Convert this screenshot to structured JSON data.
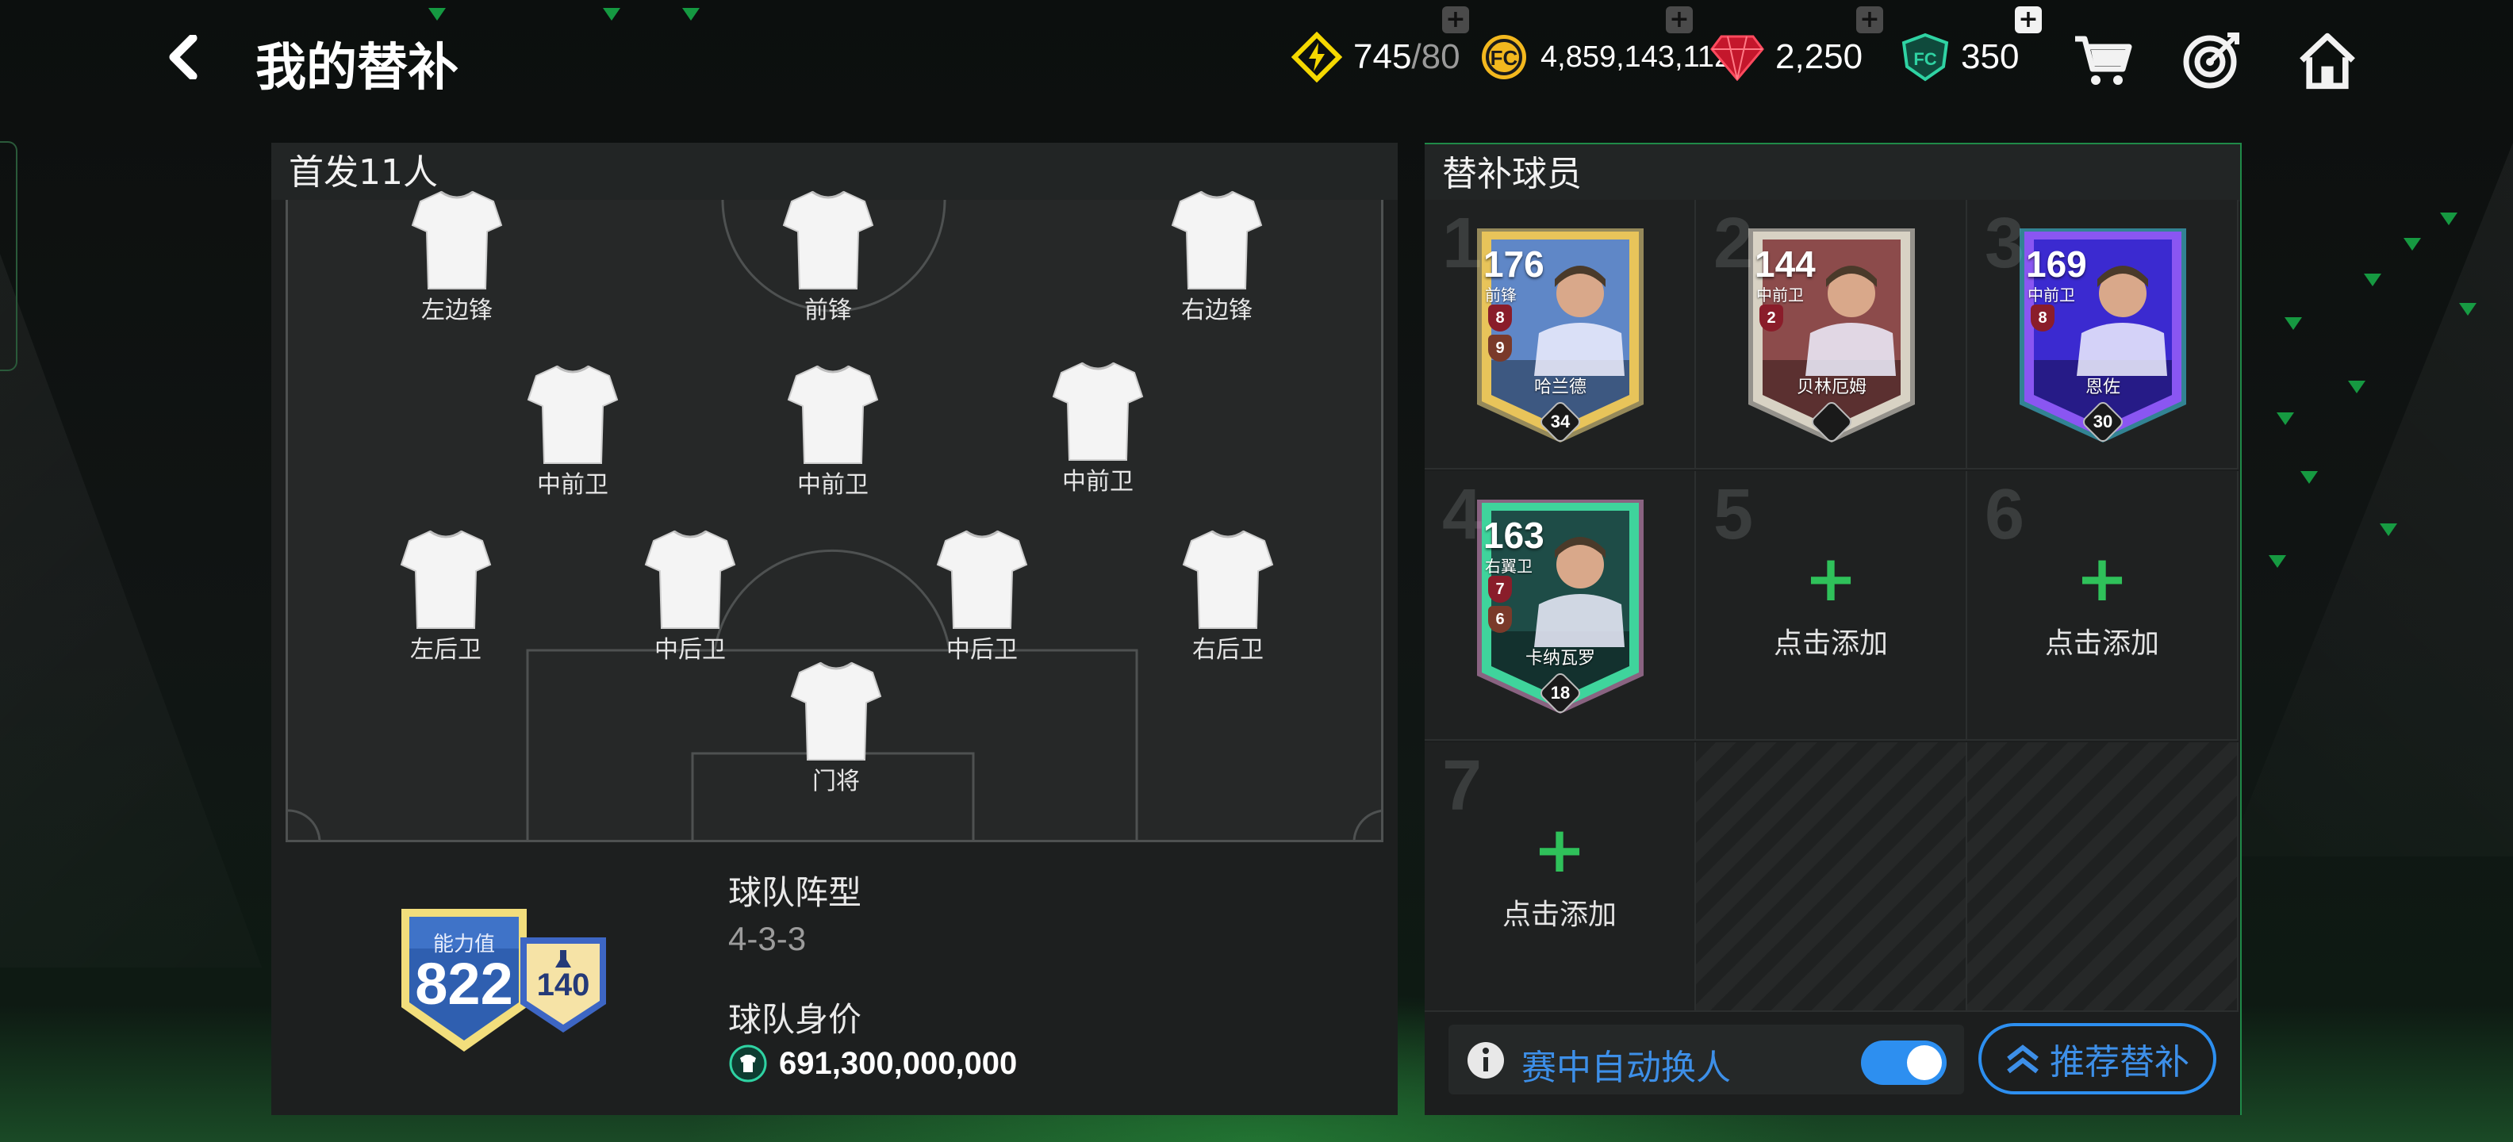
{
  "header": {
    "title": "我的替补",
    "energy": {
      "value": "745",
      "max": "/80",
      "icon": "lightning-icon"
    },
    "coins": {
      "value": "4,859,143,112",
      "icon": "coin-icon"
    },
    "gems": {
      "value": "2,250",
      "icon": "ruby-icon"
    },
    "points": {
      "value": "350",
      "icon": "shield-points-icon"
    },
    "actions": [
      "cart-icon",
      "target-icon",
      "home-icon"
    ]
  },
  "starting": {
    "title": "首发11人",
    "formation_label": "球队阵型",
    "formation": "4-3-3",
    "value_label": "球队身价",
    "team_value": "691,300,000,000",
    "rating_label": "能力值",
    "rating": "822",
    "chemistry": "140",
    "positions": [
      "左边锋",
      "前锋",
      "右边锋",
      "中前卫",
      "中前卫",
      "中前卫",
      "左后卫",
      "中后卫",
      "中后卫",
      "右后卫",
      "门将"
    ]
  },
  "subs": {
    "title": "替补球员",
    "add_label": "点击添加",
    "slots": [
      {
        "num": "1",
        "ovr": "176",
        "pos": "前锋",
        "name": "哈兰德",
        "level": "34",
        "chips": [
          "8",
          "9"
        ],
        "theme": "gold"
      },
      {
        "num": "2",
        "ovr": "144",
        "pos": "中前卫",
        "name": "贝林厄姆",
        "level": "",
        "chips": [
          "2"
        ],
        "theme": "white"
      },
      {
        "num": "3",
        "ovr": "169",
        "pos": "中前卫",
        "name": "恩佐",
        "level": "30",
        "chips": [
          "8"
        ],
        "theme": "purple"
      },
      {
        "num": "4",
        "ovr": "163",
        "pos": "右翼卫",
        "name": "卡纳瓦罗",
        "level": "18",
        "chips": [
          "7",
          "6"
        ],
        "theme": "green"
      },
      {
        "num": "5"
      },
      {
        "num": "6"
      },
      {
        "num": "7"
      }
    ]
  },
  "controls": {
    "auto_sub_label": "赛中自动换人",
    "auto_sub_on": true,
    "recommend_label": "推荐替补"
  },
  "colors": {
    "accent_blue": "#2d8ff0",
    "accent_green": "#2fc15a",
    "gold": "#f2c23a"
  }
}
